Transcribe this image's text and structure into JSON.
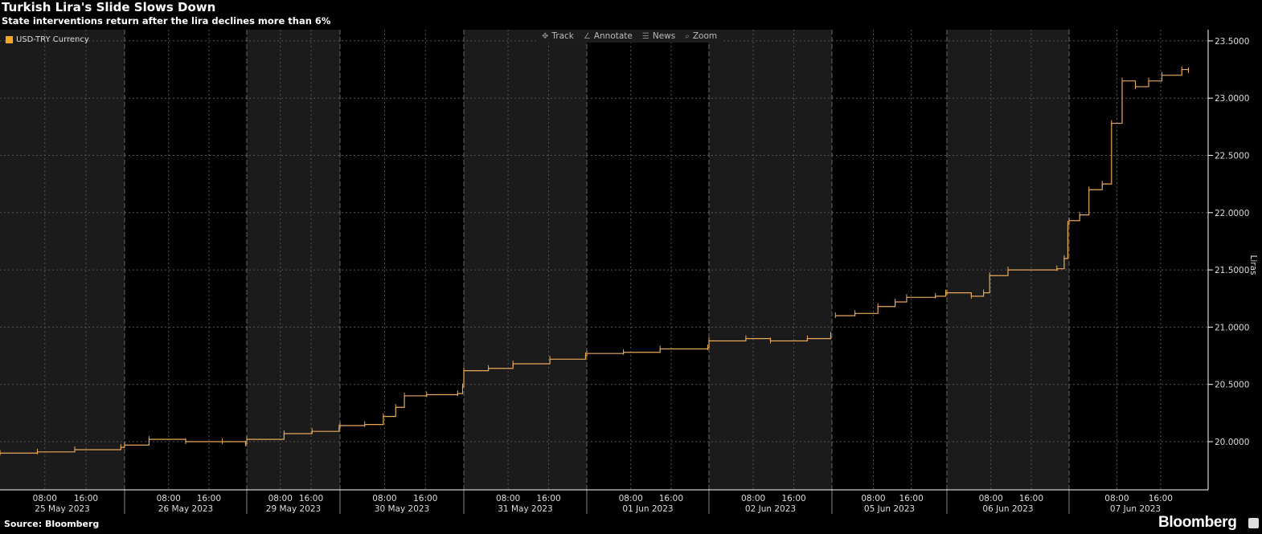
{
  "title": "Turkish Lira's Slide Slows Down",
  "subtitle": "State interventions return after the lira declines more than 6%",
  "source": "Source: Bloomberg",
  "brand": "Bloomberg",
  "toolbar": [
    {
      "label": "Track",
      "icon": "crosshair-icon",
      "glyph": "✥"
    },
    {
      "label": "Annotate",
      "icon": "pencil-icon",
      "glyph": "∠"
    },
    {
      "label": "News",
      "icon": "news-icon",
      "glyph": "☰"
    },
    {
      "label": "Zoom",
      "icon": "magnifier-icon",
      "glyph": "⌕"
    }
  ],
  "colors": {
    "line": "#e8a85a",
    "legend": "#f5a623",
    "shade": "#1b1b1b",
    "background": "#000000"
  },
  "chart_data": {
    "type": "line",
    "title": "Turkish Lira's Slide Slows Down",
    "ylabel": "Liras",
    "ylim": [
      19.75,
      23.6
    ],
    "yticks": [
      "20.0000",
      "20.5000",
      "21.0000",
      "21.5000",
      "22.0000",
      "22.5000",
      "23.0000",
      "23.5000"
    ],
    "ytick_values": [
      20.0,
      20.5,
      21.0,
      21.5,
      22.0,
      22.5,
      23.0,
      23.5
    ],
    "days": [
      "25 May 2023",
      "26 May 2023",
      "29 May 2023",
      "30 May 2023",
      "31 May 2023",
      "01 Jun 2023",
      "02 Jun 2023",
      "05 Jun 2023",
      "06 Jun 2023",
      "07 Jun 2023"
    ],
    "hour_ticks": [
      "08:00",
      "16:00"
    ],
    "legend": {
      "label": "USD-TRY Currency",
      "position": "top-left"
    },
    "grid": true,
    "series": [
      {
        "name": "USD-TRY Currency",
        "x_unit": "trading-day index (fractional)",
        "points": [
          [
            0.0,
            19.9
          ],
          [
            0.3,
            19.91
          ],
          [
            0.6,
            19.93
          ],
          [
            0.97,
            19.95
          ],
          [
            1.0,
            19.97
          ],
          [
            1.2,
            20.02
          ],
          [
            1.5,
            20.0
          ],
          [
            1.8,
            20.0
          ],
          [
            1.99,
            19.98
          ],
          [
            2.0,
            20.02
          ],
          [
            2.4,
            20.07
          ],
          [
            2.7,
            20.09
          ],
          [
            2.99,
            20.12
          ],
          [
            3.0,
            20.14
          ],
          [
            3.2,
            20.15
          ],
          [
            3.35,
            20.22
          ],
          [
            3.45,
            20.3
          ],
          [
            3.52,
            20.4
          ],
          [
            3.7,
            20.41
          ],
          [
            3.95,
            20.42
          ],
          [
            3.99,
            20.48
          ],
          [
            4.0,
            20.62
          ],
          [
            4.2,
            20.64
          ],
          [
            4.4,
            20.68
          ],
          [
            4.7,
            20.72
          ],
          [
            4.99,
            20.75
          ],
          [
            5.0,
            20.77
          ],
          [
            5.3,
            20.78
          ],
          [
            5.6,
            20.81
          ],
          [
            5.99,
            20.82
          ],
          [
            6.0,
            20.88
          ],
          [
            6.3,
            20.9
          ],
          [
            6.5,
            20.88
          ],
          [
            6.8,
            20.9
          ],
          [
            6.99,
            20.93
          ],
          [
            7.03,
            21.1
          ],
          [
            7.2,
            21.12
          ],
          [
            7.4,
            21.18
          ],
          [
            7.55,
            21.22
          ],
          [
            7.65,
            21.26
          ],
          [
            7.9,
            21.27
          ],
          [
            7.99,
            21.3
          ],
          [
            8.0,
            21.3
          ],
          [
            8.2,
            21.27
          ],
          [
            8.3,
            21.3
          ],
          [
            8.35,
            21.45
          ],
          [
            8.5,
            21.5
          ],
          [
            8.9,
            21.51
          ],
          [
            8.96,
            21.6
          ],
          [
            8.99,
            21.9
          ],
          [
            9.0,
            21.93
          ],
          [
            9.08,
            21.98
          ],
          [
            9.15,
            22.2
          ],
          [
            9.25,
            22.25
          ],
          [
            9.32,
            22.78
          ],
          [
            9.4,
            23.15
          ],
          [
            9.5,
            23.1
          ],
          [
            9.6,
            23.15
          ],
          [
            9.7,
            23.2
          ],
          [
            9.85,
            23.25
          ],
          [
            9.9,
            23.24
          ]
        ]
      }
    ]
  }
}
